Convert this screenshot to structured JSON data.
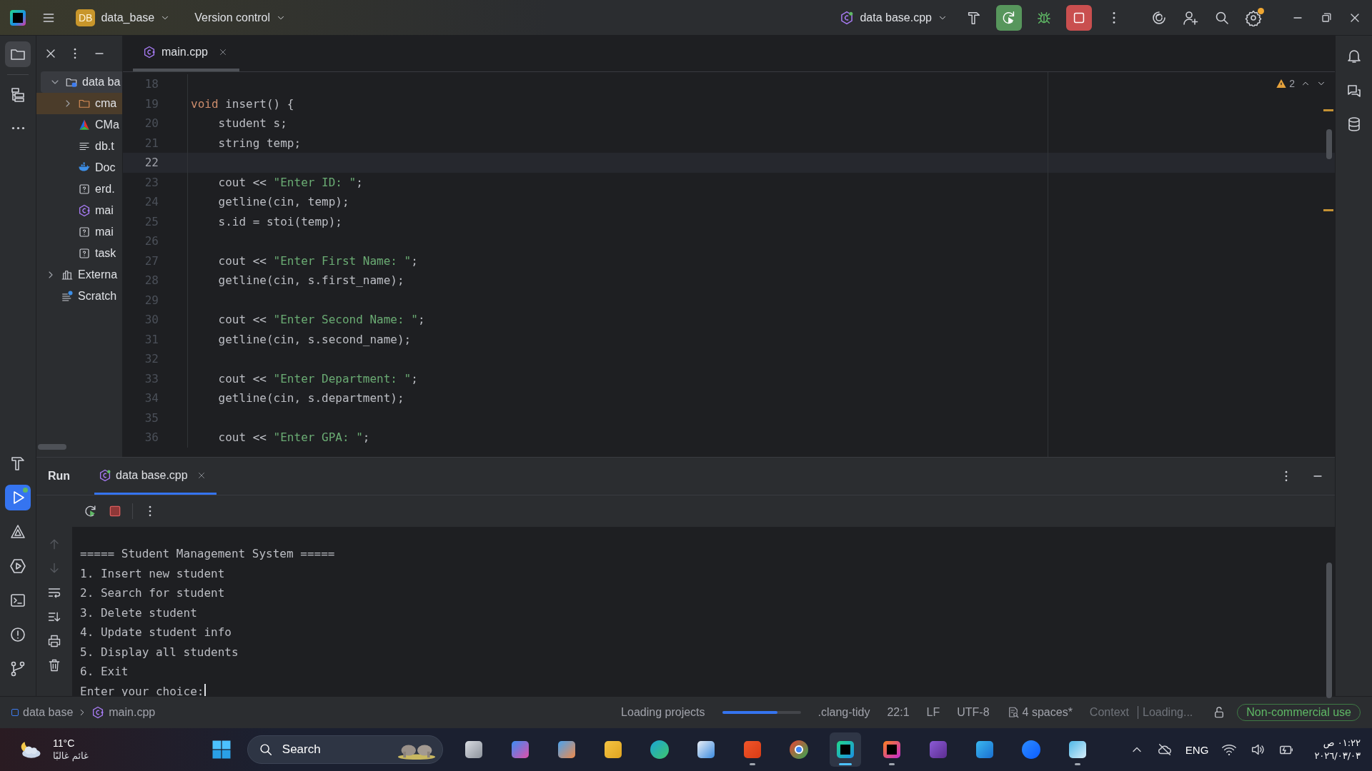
{
  "title_bar": {
    "project_badge": "DB",
    "project": "data_base",
    "vcs": "Version control",
    "run_config": "data base.cpp",
    "rerun_active": true,
    "stop_active": true,
    "settings_badge": true
  },
  "left_toolbar": {
    "top": [
      {
        "kind": "folder",
        "selected": true
      },
      {
        "kind": "structure",
        "selected": false
      },
      {
        "kind": "more",
        "selected": false
      }
    ],
    "bottom": [
      {
        "kind": "build",
        "selected": false
      },
      {
        "kind": "run",
        "selected": true
      },
      {
        "kind": "cmake",
        "selected": false
      },
      {
        "kind": "services",
        "selected": false
      },
      {
        "kind": "terminal",
        "selected": false
      },
      {
        "kind": "problems",
        "selected": false
      },
      {
        "kind": "git",
        "selected": false
      }
    ]
  },
  "project_tree": [
    {
      "name": "data ba",
      "kind": "project",
      "expanded": true,
      "selected": false,
      "children": [
        {
          "name": "cma",
          "kind": "folder",
          "expanded": false,
          "selected": true
        },
        {
          "name": "CMa",
          "kind": "cmake",
          "selected": false
        },
        {
          "name": "db.t",
          "kind": "text",
          "selected": false
        },
        {
          "name": "Doc",
          "kind": "docker",
          "selected": false
        },
        {
          "name": "erd.",
          "kind": "unknown",
          "selected": false
        },
        {
          "name": "mai",
          "kind": "cpp",
          "selected": false
        },
        {
          "name": "mai",
          "kind": "unknown",
          "selected": false
        },
        {
          "name": "task",
          "kind": "unknown",
          "selected": false
        }
      ]
    },
    {
      "name": "Externa",
      "kind": "library",
      "expanded": false,
      "selected": false
    },
    {
      "name": "Scratch",
      "kind": "scratch",
      "selected": false
    }
  ],
  "editor": {
    "tab": {
      "name": "main.cpp",
      "selected": true
    },
    "warnings": "2",
    "lines": [
      {
        "num": "18",
        "current": false
      },
      {
        "num": "19",
        "current": false,
        "code": [
          {
            "kind": "keyword",
            "text": "void"
          },
          {
            "kind": "plain",
            "text": " insert() {"
          }
        ]
      },
      {
        "num": "20",
        "current": false,
        "code": [
          {
            "kind": "plain",
            "text": "    student s;"
          }
        ]
      },
      {
        "num": "21",
        "current": false,
        "code": [
          {
            "kind": "plain",
            "text": "    string temp;"
          }
        ]
      },
      {
        "num": "22",
        "current": true
      },
      {
        "num": "23",
        "current": false,
        "code": [
          {
            "kind": "plain",
            "text": "    cout << "
          },
          {
            "kind": "string",
            "text": "\"Enter ID: \""
          },
          {
            "kind": "plain",
            "text": ";"
          }
        ]
      },
      {
        "num": "24",
        "current": false,
        "code": [
          {
            "kind": "plain",
            "text": "    getline(cin, temp);"
          }
        ]
      },
      {
        "num": "25",
        "current": false,
        "code": [
          {
            "kind": "plain",
            "text": "    s.id = stoi(temp);"
          }
        ]
      },
      {
        "num": "26",
        "current": false
      },
      {
        "num": "27",
        "current": false,
        "code": [
          {
            "kind": "plain",
            "text": "    cout << "
          },
          {
            "kind": "string",
            "text": "\"Enter First Name: \""
          },
          {
            "kind": "plain",
            "text": ";"
          }
        ]
      },
      {
        "num": "28",
        "current": false,
        "code": [
          {
            "kind": "plain",
            "text": "    getline(cin, s.first_name);"
          }
        ]
      },
      {
        "num": "29",
        "current": false
      },
      {
        "num": "30",
        "current": false,
        "code": [
          {
            "kind": "plain",
            "text": "    cout << "
          },
          {
            "kind": "string",
            "text": "\"Enter Second Name: \""
          },
          {
            "kind": "plain",
            "text": ";"
          }
        ]
      },
      {
        "num": "31",
        "current": false,
        "code": [
          {
            "kind": "plain",
            "text": "    getline(cin, s.second_name);"
          }
        ]
      },
      {
        "num": "32",
        "current": false
      },
      {
        "num": "33",
        "current": false,
        "code": [
          {
            "kind": "plain",
            "text": "    cout << "
          },
          {
            "kind": "string",
            "text": "\"Enter Department: \""
          },
          {
            "kind": "plain",
            "text": ";"
          }
        ]
      },
      {
        "num": "34",
        "current": false,
        "code": [
          {
            "kind": "plain",
            "text": "    getline(cin, s.department);"
          }
        ]
      },
      {
        "num": "35",
        "current": false
      },
      {
        "num": "36",
        "current": false,
        "code": [
          {
            "kind": "plain",
            "text": "    cout << "
          },
          {
            "kind": "string",
            "text": "\"Enter GPA: \""
          },
          {
            "kind": "plain",
            "text": ";"
          }
        ]
      }
    ]
  },
  "right_toolbar": [
    {
      "kind": "bell"
    },
    {
      "kind": "ai"
    },
    {
      "kind": "database"
    }
  ],
  "run_panel": {
    "title": "Run",
    "tab": {
      "name": "data base.cpp",
      "selected": true
    },
    "output": [
      "===== Student Management System =====",
      "1. Insert new student",
      "2. Search for student",
      "3. Delete student",
      "4. Update student info",
      "5. Display all students",
      "6. Exit",
      "Enter your choice:"
    ]
  },
  "status_bar": {
    "breadcrumb": [
      "data base",
      "main.cpp"
    ],
    "progress": {
      "label": "Loading projects",
      "level": 0.7
    },
    "items": [
      ".clang-tidy",
      "22:1",
      "LF",
      "UTF-8"
    ],
    "indent": "4 spaces*",
    "context": "Context",
    "context_state": "Loading...",
    "license": "Non-commercial use"
  },
  "taskbar": {
    "weather": {
      "temp": "11°C",
      "condition": "غائم غالبًا"
    },
    "search": {
      "label": "Search"
    },
    "apps": [
      {
        "kind": "taskview",
        "running": false,
        "selected": false
      },
      {
        "kind": "copilot",
        "running": false,
        "selected": false
      },
      {
        "kind": "people",
        "running": false,
        "selected": false
      },
      {
        "kind": "files",
        "running": false,
        "selected": false
      },
      {
        "kind": "edge",
        "running": false,
        "selected": false
      },
      {
        "kind": "store",
        "running": false,
        "selected": false
      },
      {
        "kind": "brave",
        "running": true,
        "selected": false
      },
      {
        "kind": "chrome",
        "running": false,
        "selected": false
      },
      {
        "kind": "clion",
        "running": true,
        "selected": true
      },
      {
        "kind": "intellij",
        "running": true,
        "selected": false
      },
      {
        "kind": "studio",
        "running": false,
        "selected": false
      },
      {
        "kind": "azure",
        "running": false,
        "selected": false
      },
      {
        "kind": "zoom",
        "running": false,
        "selected": false
      },
      {
        "kind": "notepad",
        "running": true,
        "selected": false
      }
    ],
    "language": "ENG",
    "time": "٠١:٢٢ ص",
    "date": "٢٠٢٦/٠٣/٠٣"
  }
}
